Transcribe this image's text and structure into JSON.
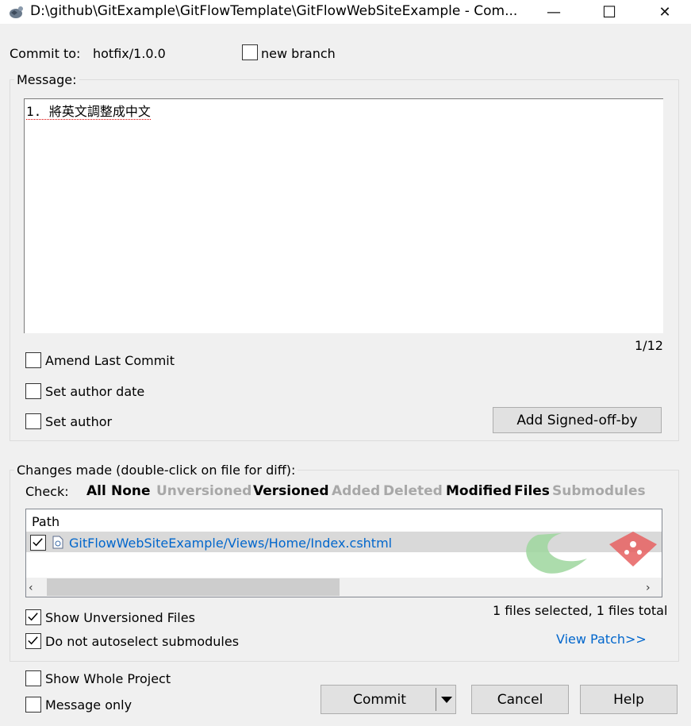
{
  "window": {
    "title": "D:\\github\\GitExample\\GitFlowTemplate\\GitFlowWebSiteExample - Com...",
    "minimize_glyph": "—",
    "maximize_glyph": "☐",
    "close_glyph": "✕"
  },
  "commit_to": {
    "label": "Commit to:",
    "branch": "hotfix/1.0.0",
    "new_branch_label": "new branch",
    "new_branch_checked": false
  },
  "message": {
    "group_label": "Message:",
    "text": "1. 將英文調整成中文",
    "counter": "1/12"
  },
  "options": {
    "amend_last_commit": {
      "label": "Amend Last Commit",
      "checked": false
    },
    "set_author_date": {
      "label": "Set author date",
      "checked": false
    },
    "set_author": {
      "label": "Set author",
      "checked": false
    },
    "add_signed_off_by": "Add Signed-off-by"
  },
  "changes": {
    "group_label": "Changes made (double-click on file for diff):",
    "check_label": "Check:",
    "filters": [
      {
        "label": "All",
        "enabled": true
      },
      {
        "label": "None",
        "enabled": true
      },
      {
        "label": "Unversioned",
        "enabled": false
      },
      {
        "label": "Versioned",
        "enabled": true
      },
      {
        "label": "Added",
        "enabled": false
      },
      {
        "label": "Deleted",
        "enabled": false
      },
      {
        "label": "Modified",
        "enabled": true
      },
      {
        "label": "Files",
        "enabled": true
      },
      {
        "label": "Submodules",
        "enabled": false
      }
    ],
    "column_path": "Path",
    "files": [
      {
        "path": "GitFlowWebSiteExample/Views/Home/Index.cshtml",
        "checked": true
      }
    ],
    "selection_summary": "1 files selected, 1 files total",
    "show_unversioned": {
      "label": "Show Unversioned Files",
      "checked": true
    },
    "no_autoselect_submodules": {
      "label": "Do not autoselect submodules",
      "checked": true
    },
    "view_patch": "View Patch>>"
  },
  "bottom": {
    "show_whole_project": {
      "label": "Show Whole Project",
      "checked": false
    },
    "message_only": {
      "label": "Message only",
      "checked": false
    },
    "commit_button": "Commit",
    "cancel_button": "Cancel",
    "help_button": "Help"
  },
  "colors": {
    "link": "#0066cc",
    "disabled_filter": "#a8a8a8",
    "selected_row": "#d9d9d9",
    "accent_green": "#7ec87e",
    "accent_red": "#e05050"
  }
}
